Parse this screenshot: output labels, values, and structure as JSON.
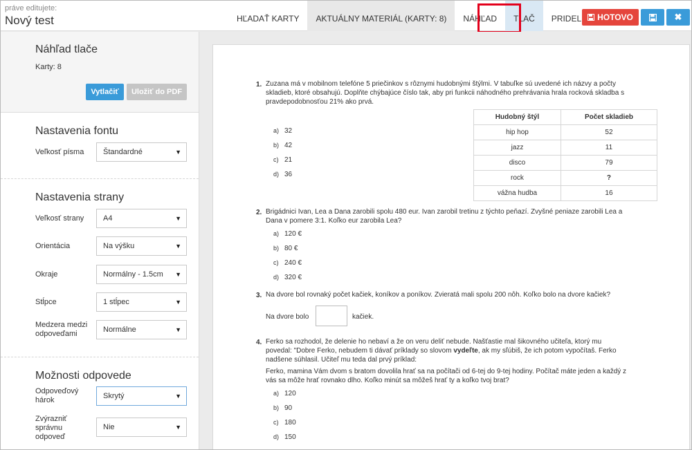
{
  "header": {
    "editing_label": "práve editujete:",
    "title": "Nový test",
    "tabs": [
      {
        "label": "HĽADAŤ KARTY"
      },
      {
        "label": "AKTUÁLNY MATERIÁL (KARTY: 8)"
      },
      {
        "label": "NÁHĽAD"
      },
      {
        "label": "TLAČ"
      },
      {
        "label": "PRIDELIŤ"
      }
    ],
    "done_label": "HOTOVO",
    "save_icon": "floppy-disk-icon",
    "close_icon": "close-icon"
  },
  "sidebar": {
    "preview": {
      "title": "Náhľad tlače",
      "cards": "Karty: 8",
      "print_label": "Vytlačiť",
      "pdf_label": "Uložiť do PDF"
    },
    "font_settings": {
      "title": "Nastavenia fontu",
      "font_size_label": "Veľkosť písma",
      "font_size_value": "Štandardné"
    },
    "page_settings": {
      "title": "Nastavenia strany",
      "page_size_label": "Veľkosť strany",
      "page_size_value": "A4",
      "orientation_label": "Orientácia",
      "orientation_value": "Na výšku",
      "margins_label": "Okraje",
      "margins_value": "Normálny - 1.5cm",
      "columns_label": "Stĺpce",
      "columns_value": "1 stĺpec",
      "spacing_label": "Medzera medzi odpoveďami",
      "spacing_value": "Normálne"
    },
    "answer_options": {
      "title": "Možnosti odpovede",
      "sheet_label": "Odpoveďový hárok",
      "sheet_value": "Skrytý",
      "highlight_label": "Zvýrazniť správnu odpoveď",
      "highlight_value": "Nie"
    }
  },
  "paper": {
    "q1": {
      "num": "1.",
      "text_l1": "Zuzana má v mobilnom telefóne 5 priečinkov s rôznymi hudobnými štýlmi. V tabuľke sú uvedené ich názvy a počty",
      "text_l2": "skladieb, ktoré obsahujú. Doplňte chýbajúce číslo tak, aby pri funkcii náhodného prehrávania hrala rocková skladba s",
      "text_l3": "pravdepodobnosťou 21% ako prvá.",
      "options": [
        {
          "letter": "a)",
          "value": "32"
        },
        {
          "letter": "b)",
          "value": "42"
        },
        {
          "letter": "c)",
          "value": "21"
        },
        {
          "letter": "d)",
          "value": "36"
        }
      ],
      "table": {
        "headers": [
          "Hudobný štýl",
          "Počet skladieb"
        ],
        "rows": [
          [
            "hip hop",
            "52"
          ],
          [
            "jazz",
            "11"
          ],
          [
            "disco",
            "79"
          ],
          [
            "rock",
            "?"
          ],
          [
            "vážna hudba",
            "16"
          ]
        ]
      }
    },
    "q2": {
      "num": "2.",
      "text_l1": "Brigádnici Ivan, Lea a Dana zarobili spolu 480 eur. Ivan zarobil tretinu z týchto peňazí. Zvyšné peniaze zarobili Lea a",
      "text_l2": "Dana v pomere 3:1. Koľko eur zarobila Lea?",
      "options": [
        {
          "letter": "a)",
          "value": "120 €"
        },
        {
          "letter": "b)",
          "value": "80 €"
        },
        {
          "letter": "c)",
          "value": "240 €"
        },
        {
          "letter": "d)",
          "value": "320 €"
        }
      ]
    },
    "q3": {
      "num": "3.",
      "text": "Na dvore bol rovnaký počet kačiek, koníkov a poníkov. Zvieratá mali spolu 200 nôh. Koľko bolo na dvore kačiek?",
      "prefix": "Na dvore bolo",
      "suffix": "kačiek."
    },
    "q4": {
      "num": "4.",
      "text_l1": "Ferko sa rozhodol, že delenie ho nebaví a že on veru deliť nebude. Našťastie mal šikovného učiteľa, ktorý mu",
      "text_l2a": "povedal: \"Dobre Ferko, nebudem ti dávať príklady so slovom ",
      "text_l2b": "vydeľte",
      "text_l2c": ", ak my sľúbiš, že ich potom vypočítaš. Ferko",
      "text_l3": "nadšene súhlasil. Učiteľ mu teda dal prvý príklad:",
      "text_l4": "Ferko, mamina Vám dvom s bratom dovolila hrať sa na počítači od 6-tej do 9-tej hodiny. Počítač máte jeden a každý z",
      "text_l5": "vás sa môže hrať rovnako dlho. Koľko minút sa môžeš hrať ty a koľko tvoj brat?",
      "options": [
        {
          "letter": "a)",
          "value": "120"
        },
        {
          "letter": "b)",
          "value": "90"
        },
        {
          "letter": "c)",
          "value": "180"
        },
        {
          "letter": "d)",
          "value": "150"
        }
      ]
    }
  }
}
